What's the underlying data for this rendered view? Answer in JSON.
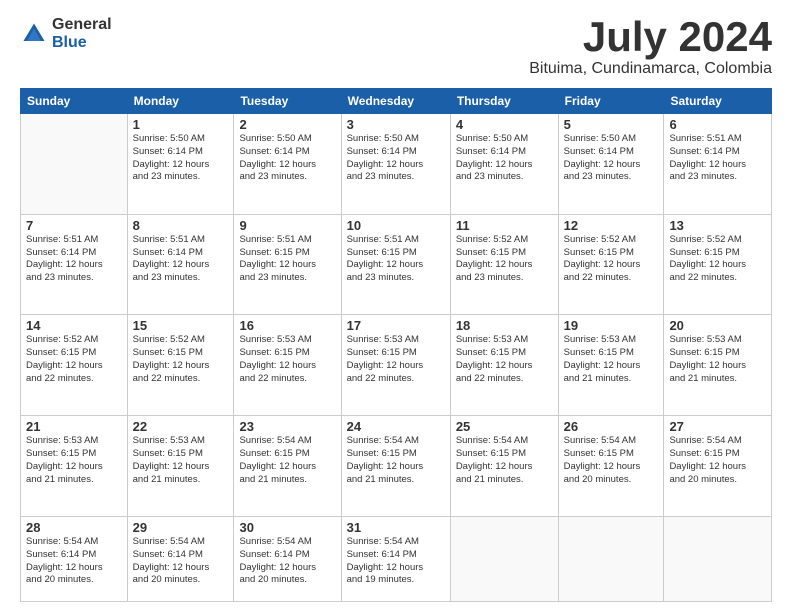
{
  "logo": {
    "general": "General",
    "blue": "Blue"
  },
  "title": {
    "month_year": "July 2024",
    "location": "Bituima, Cundinamarca, Colombia"
  },
  "days_header": [
    "Sunday",
    "Monday",
    "Tuesday",
    "Wednesday",
    "Thursday",
    "Friday",
    "Saturday"
  ],
  "weeks": [
    [
      {
        "day": "",
        "info": ""
      },
      {
        "day": "1",
        "info": "Sunrise: 5:50 AM\nSunset: 6:14 PM\nDaylight: 12 hours\nand 23 minutes."
      },
      {
        "day": "2",
        "info": "Sunrise: 5:50 AM\nSunset: 6:14 PM\nDaylight: 12 hours\nand 23 minutes."
      },
      {
        "day": "3",
        "info": "Sunrise: 5:50 AM\nSunset: 6:14 PM\nDaylight: 12 hours\nand 23 minutes."
      },
      {
        "day": "4",
        "info": "Sunrise: 5:50 AM\nSunset: 6:14 PM\nDaylight: 12 hours\nand 23 minutes."
      },
      {
        "day": "5",
        "info": "Sunrise: 5:50 AM\nSunset: 6:14 PM\nDaylight: 12 hours\nand 23 minutes."
      },
      {
        "day": "6",
        "info": "Sunrise: 5:51 AM\nSunset: 6:14 PM\nDaylight: 12 hours\nand 23 minutes."
      }
    ],
    [
      {
        "day": "7",
        "info": "Sunrise: 5:51 AM\nSunset: 6:14 PM\nDaylight: 12 hours\nand 23 minutes."
      },
      {
        "day": "8",
        "info": "Sunrise: 5:51 AM\nSunset: 6:14 PM\nDaylight: 12 hours\nand 23 minutes."
      },
      {
        "day": "9",
        "info": "Sunrise: 5:51 AM\nSunset: 6:15 PM\nDaylight: 12 hours\nand 23 minutes."
      },
      {
        "day": "10",
        "info": "Sunrise: 5:51 AM\nSunset: 6:15 PM\nDaylight: 12 hours\nand 23 minutes."
      },
      {
        "day": "11",
        "info": "Sunrise: 5:52 AM\nSunset: 6:15 PM\nDaylight: 12 hours\nand 23 minutes."
      },
      {
        "day": "12",
        "info": "Sunrise: 5:52 AM\nSunset: 6:15 PM\nDaylight: 12 hours\nand 22 minutes."
      },
      {
        "day": "13",
        "info": "Sunrise: 5:52 AM\nSunset: 6:15 PM\nDaylight: 12 hours\nand 22 minutes."
      }
    ],
    [
      {
        "day": "14",
        "info": "Sunrise: 5:52 AM\nSunset: 6:15 PM\nDaylight: 12 hours\nand 22 minutes."
      },
      {
        "day": "15",
        "info": "Sunrise: 5:52 AM\nSunset: 6:15 PM\nDaylight: 12 hours\nand 22 minutes."
      },
      {
        "day": "16",
        "info": "Sunrise: 5:53 AM\nSunset: 6:15 PM\nDaylight: 12 hours\nand 22 minutes."
      },
      {
        "day": "17",
        "info": "Sunrise: 5:53 AM\nSunset: 6:15 PM\nDaylight: 12 hours\nand 22 minutes."
      },
      {
        "day": "18",
        "info": "Sunrise: 5:53 AM\nSunset: 6:15 PM\nDaylight: 12 hours\nand 22 minutes."
      },
      {
        "day": "19",
        "info": "Sunrise: 5:53 AM\nSunset: 6:15 PM\nDaylight: 12 hours\nand 21 minutes."
      },
      {
        "day": "20",
        "info": "Sunrise: 5:53 AM\nSunset: 6:15 PM\nDaylight: 12 hours\nand 21 minutes."
      }
    ],
    [
      {
        "day": "21",
        "info": "Sunrise: 5:53 AM\nSunset: 6:15 PM\nDaylight: 12 hours\nand 21 minutes."
      },
      {
        "day": "22",
        "info": "Sunrise: 5:53 AM\nSunset: 6:15 PM\nDaylight: 12 hours\nand 21 minutes."
      },
      {
        "day": "23",
        "info": "Sunrise: 5:54 AM\nSunset: 6:15 PM\nDaylight: 12 hours\nand 21 minutes."
      },
      {
        "day": "24",
        "info": "Sunrise: 5:54 AM\nSunset: 6:15 PM\nDaylight: 12 hours\nand 21 minutes."
      },
      {
        "day": "25",
        "info": "Sunrise: 5:54 AM\nSunset: 6:15 PM\nDaylight: 12 hours\nand 21 minutes."
      },
      {
        "day": "26",
        "info": "Sunrise: 5:54 AM\nSunset: 6:15 PM\nDaylight: 12 hours\nand 20 minutes."
      },
      {
        "day": "27",
        "info": "Sunrise: 5:54 AM\nSunset: 6:15 PM\nDaylight: 12 hours\nand 20 minutes."
      }
    ],
    [
      {
        "day": "28",
        "info": "Sunrise: 5:54 AM\nSunset: 6:14 PM\nDaylight: 12 hours\nand 20 minutes."
      },
      {
        "day": "29",
        "info": "Sunrise: 5:54 AM\nSunset: 6:14 PM\nDaylight: 12 hours\nand 20 minutes."
      },
      {
        "day": "30",
        "info": "Sunrise: 5:54 AM\nSunset: 6:14 PM\nDaylight: 12 hours\nand 20 minutes."
      },
      {
        "day": "31",
        "info": "Sunrise: 5:54 AM\nSunset: 6:14 PM\nDaylight: 12 hours\nand 19 minutes."
      },
      {
        "day": "",
        "info": ""
      },
      {
        "day": "",
        "info": ""
      },
      {
        "day": "",
        "info": ""
      }
    ]
  ]
}
